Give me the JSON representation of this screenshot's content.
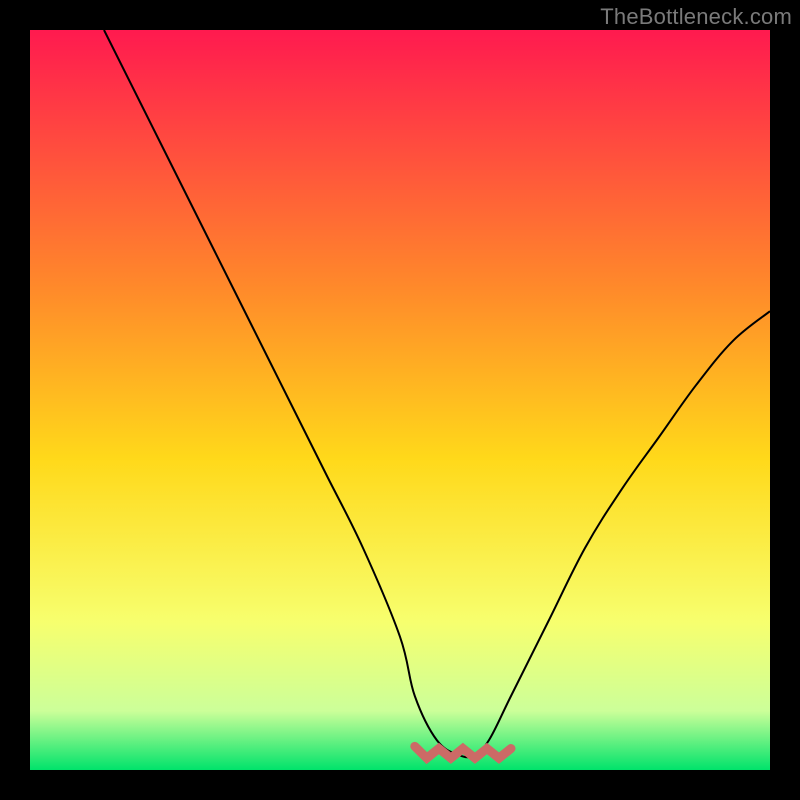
{
  "watermark": "TheBottleneck.com",
  "colors": {
    "frame_black": "#000000",
    "gradient_top": "#ff1a4f",
    "gradient_mid_upper": "#ff8a2a",
    "gradient_mid": "#ffd91a",
    "gradient_low": "#f7ff6e",
    "gradient_near_bottom": "#ccff99",
    "gradient_bottom": "#00e36b",
    "curve_black": "#000000",
    "tolerance_band": "#cc6a66"
  },
  "chart_data": {
    "type": "line",
    "title": "",
    "xlabel": "",
    "ylabel": "",
    "xlim": [
      0,
      100
    ],
    "ylim": [
      0,
      100
    ],
    "series": [
      {
        "name": "bottleneck-curve",
        "x": [
          10,
          15,
          20,
          25,
          30,
          35,
          40,
          45,
          50,
          52,
          55,
          58,
          60,
          62,
          65,
          70,
          75,
          80,
          85,
          90,
          95,
          100
        ],
        "y": [
          100,
          90,
          80,
          70,
          60,
          50,
          40,
          30,
          18,
          10,
          4,
          2,
          2,
          4,
          10,
          20,
          30,
          38,
          45,
          52,
          58,
          62
        ]
      }
    ],
    "tolerance_band": {
      "x_range": [
        52,
        65
      ],
      "y": 2
    }
  }
}
